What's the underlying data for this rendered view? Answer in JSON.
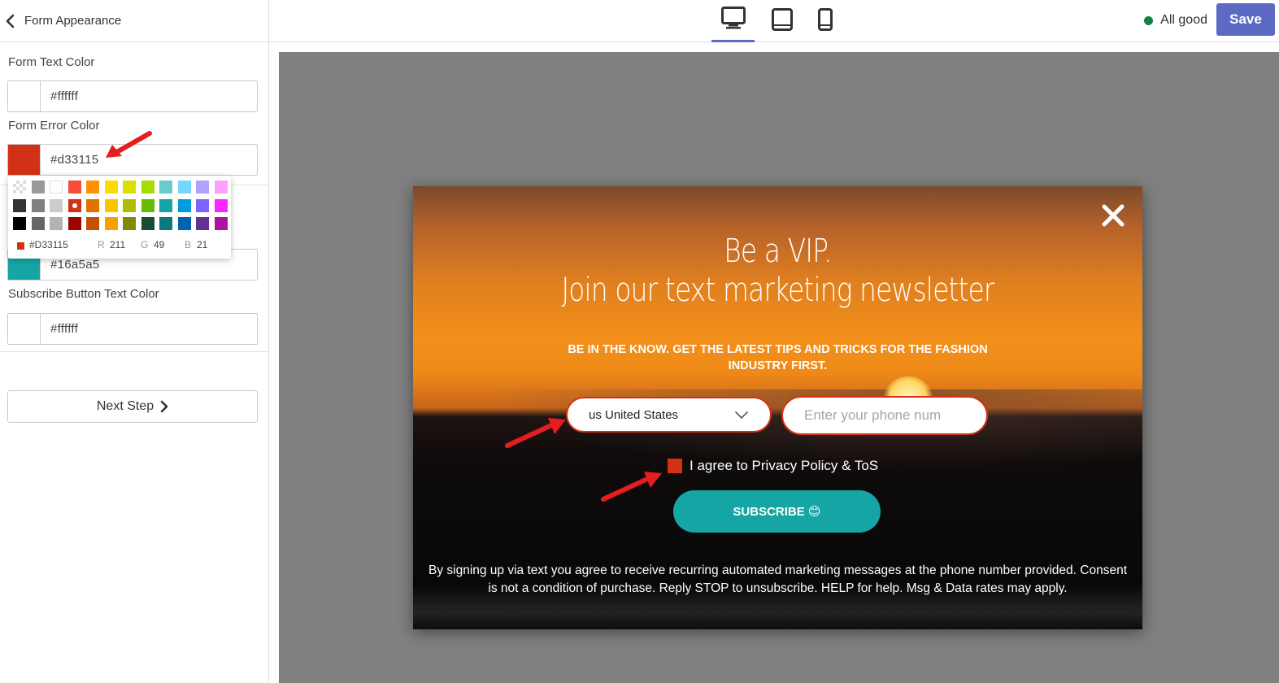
{
  "sidebar": {
    "header": {
      "back_icon": "chevron-left-icon",
      "title": "Form Appearance"
    },
    "fields": {
      "text_color": {
        "label": "Form Text Color",
        "value": "#ffffff",
        "swatch": "#ffffff"
      },
      "error_color": {
        "label": "Form Error Color",
        "value": "#d33115",
        "swatch": "#d33115"
      },
      "button_color": {
        "value": "#16a5a5",
        "swatch": "#16a5a5"
      },
      "button_text_color": {
        "label": "Subscribe Button Text Color",
        "value": "#ffffff",
        "swatch": "#ffffff"
      }
    },
    "next_step": {
      "label": "Next Step",
      "icon": "chevron-right-icon"
    }
  },
  "color_picker": {
    "swatches": [
      [
        "transparent",
        "#999999",
        "#ffffff",
        "#f44e3b",
        "#fe9200",
        "#fcdc00",
        "#dbdf00",
        "#a4dd00",
        "#68cccb",
        "#73d8ff",
        "#aea1ff",
        "#fda1ff"
      ],
      [
        "#333333",
        "#808080",
        "#cccccc",
        "#d33115",
        "#e27300",
        "#fcc400",
        "#b0bc00",
        "#68bc00",
        "#16a5a5",
        "#009ce0",
        "#7b64ff",
        "#fa28ff"
      ],
      [
        "#000000",
        "#666666",
        "#b3b3b3",
        "#9f0500",
        "#c45100",
        "#fb9e00",
        "#808900",
        "#194d33",
        "#0c797d",
        "#0062b1",
        "#653294",
        "#ab149e"
      ]
    ],
    "selected": "#d33115",
    "readout": {
      "hex": "#D33115",
      "r_label": "R",
      "r": "211",
      "g_label": "G",
      "g": "49",
      "b_label": "B",
      "b": "21"
    }
  },
  "topbar": {
    "devices": [
      {
        "name": "desktop-icon",
        "active": true
      },
      {
        "name": "tablet-icon",
        "active": false
      },
      {
        "name": "mobile-icon",
        "active": false
      }
    ],
    "status": {
      "label": "All good",
      "color": "#108043"
    },
    "save_label": "Save"
  },
  "popup": {
    "close_icon": "close-icon",
    "title_line1": "Be a VIP.",
    "title_line2": "Join our text marketing newsletter",
    "subtitle": "BE IN THE KNOW. GET THE LATEST TIPS AND TRICKS FOR THE FASHION INDUSTRY FIRST.",
    "country_select": {
      "value": "us United States",
      "icon": "chevron-down-icon"
    },
    "phone_input": {
      "placeholder": "Enter your phone num",
      "value": ""
    },
    "agree_label": "I agree to Privacy Policy & ToS",
    "subscribe_label": "SUBSCRIBE 😊",
    "disclaimer_line1": "By signing up via text you agree to receive recurring automated marketing messages at the phone number provided. Consent",
    "disclaimer_line2": "is not a condition of purchase. Reply STOP to unsubscribe. HELP for help. Msg & Data rates may apply.",
    "error_color": "#d33115",
    "button_color": "#16a5a5"
  },
  "theme": {
    "accent": "#5c6ac4",
    "preview_bg": "#808080",
    "annotation_arrow": "#e41e1e"
  }
}
